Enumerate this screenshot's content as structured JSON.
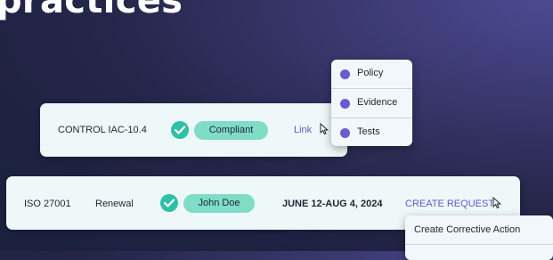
{
  "headline": "practices",
  "control_card": {
    "control_id": "CONTROL IAC-10.4",
    "status": "Compliant",
    "link_label": "Link"
  },
  "dropdown": {
    "items": [
      {
        "label": "Policy"
      },
      {
        "label": "Evidence"
      },
      {
        "label": "Tests"
      }
    ]
  },
  "request_card": {
    "standard": "ISO 27001",
    "type": "Renewal",
    "assignee": "John Doe",
    "date_range": "JUNE 12-AUG 4, 2024",
    "action_label": "CREATE REQUEST"
  },
  "action_menu": {
    "items": [
      {
        "label": "Create Corrective Action"
      }
    ]
  },
  "colors": {
    "accent": "#5b5bc9",
    "success": "#2fc0a6",
    "pill": "#7fdcc6",
    "card": "#eef8f8"
  }
}
